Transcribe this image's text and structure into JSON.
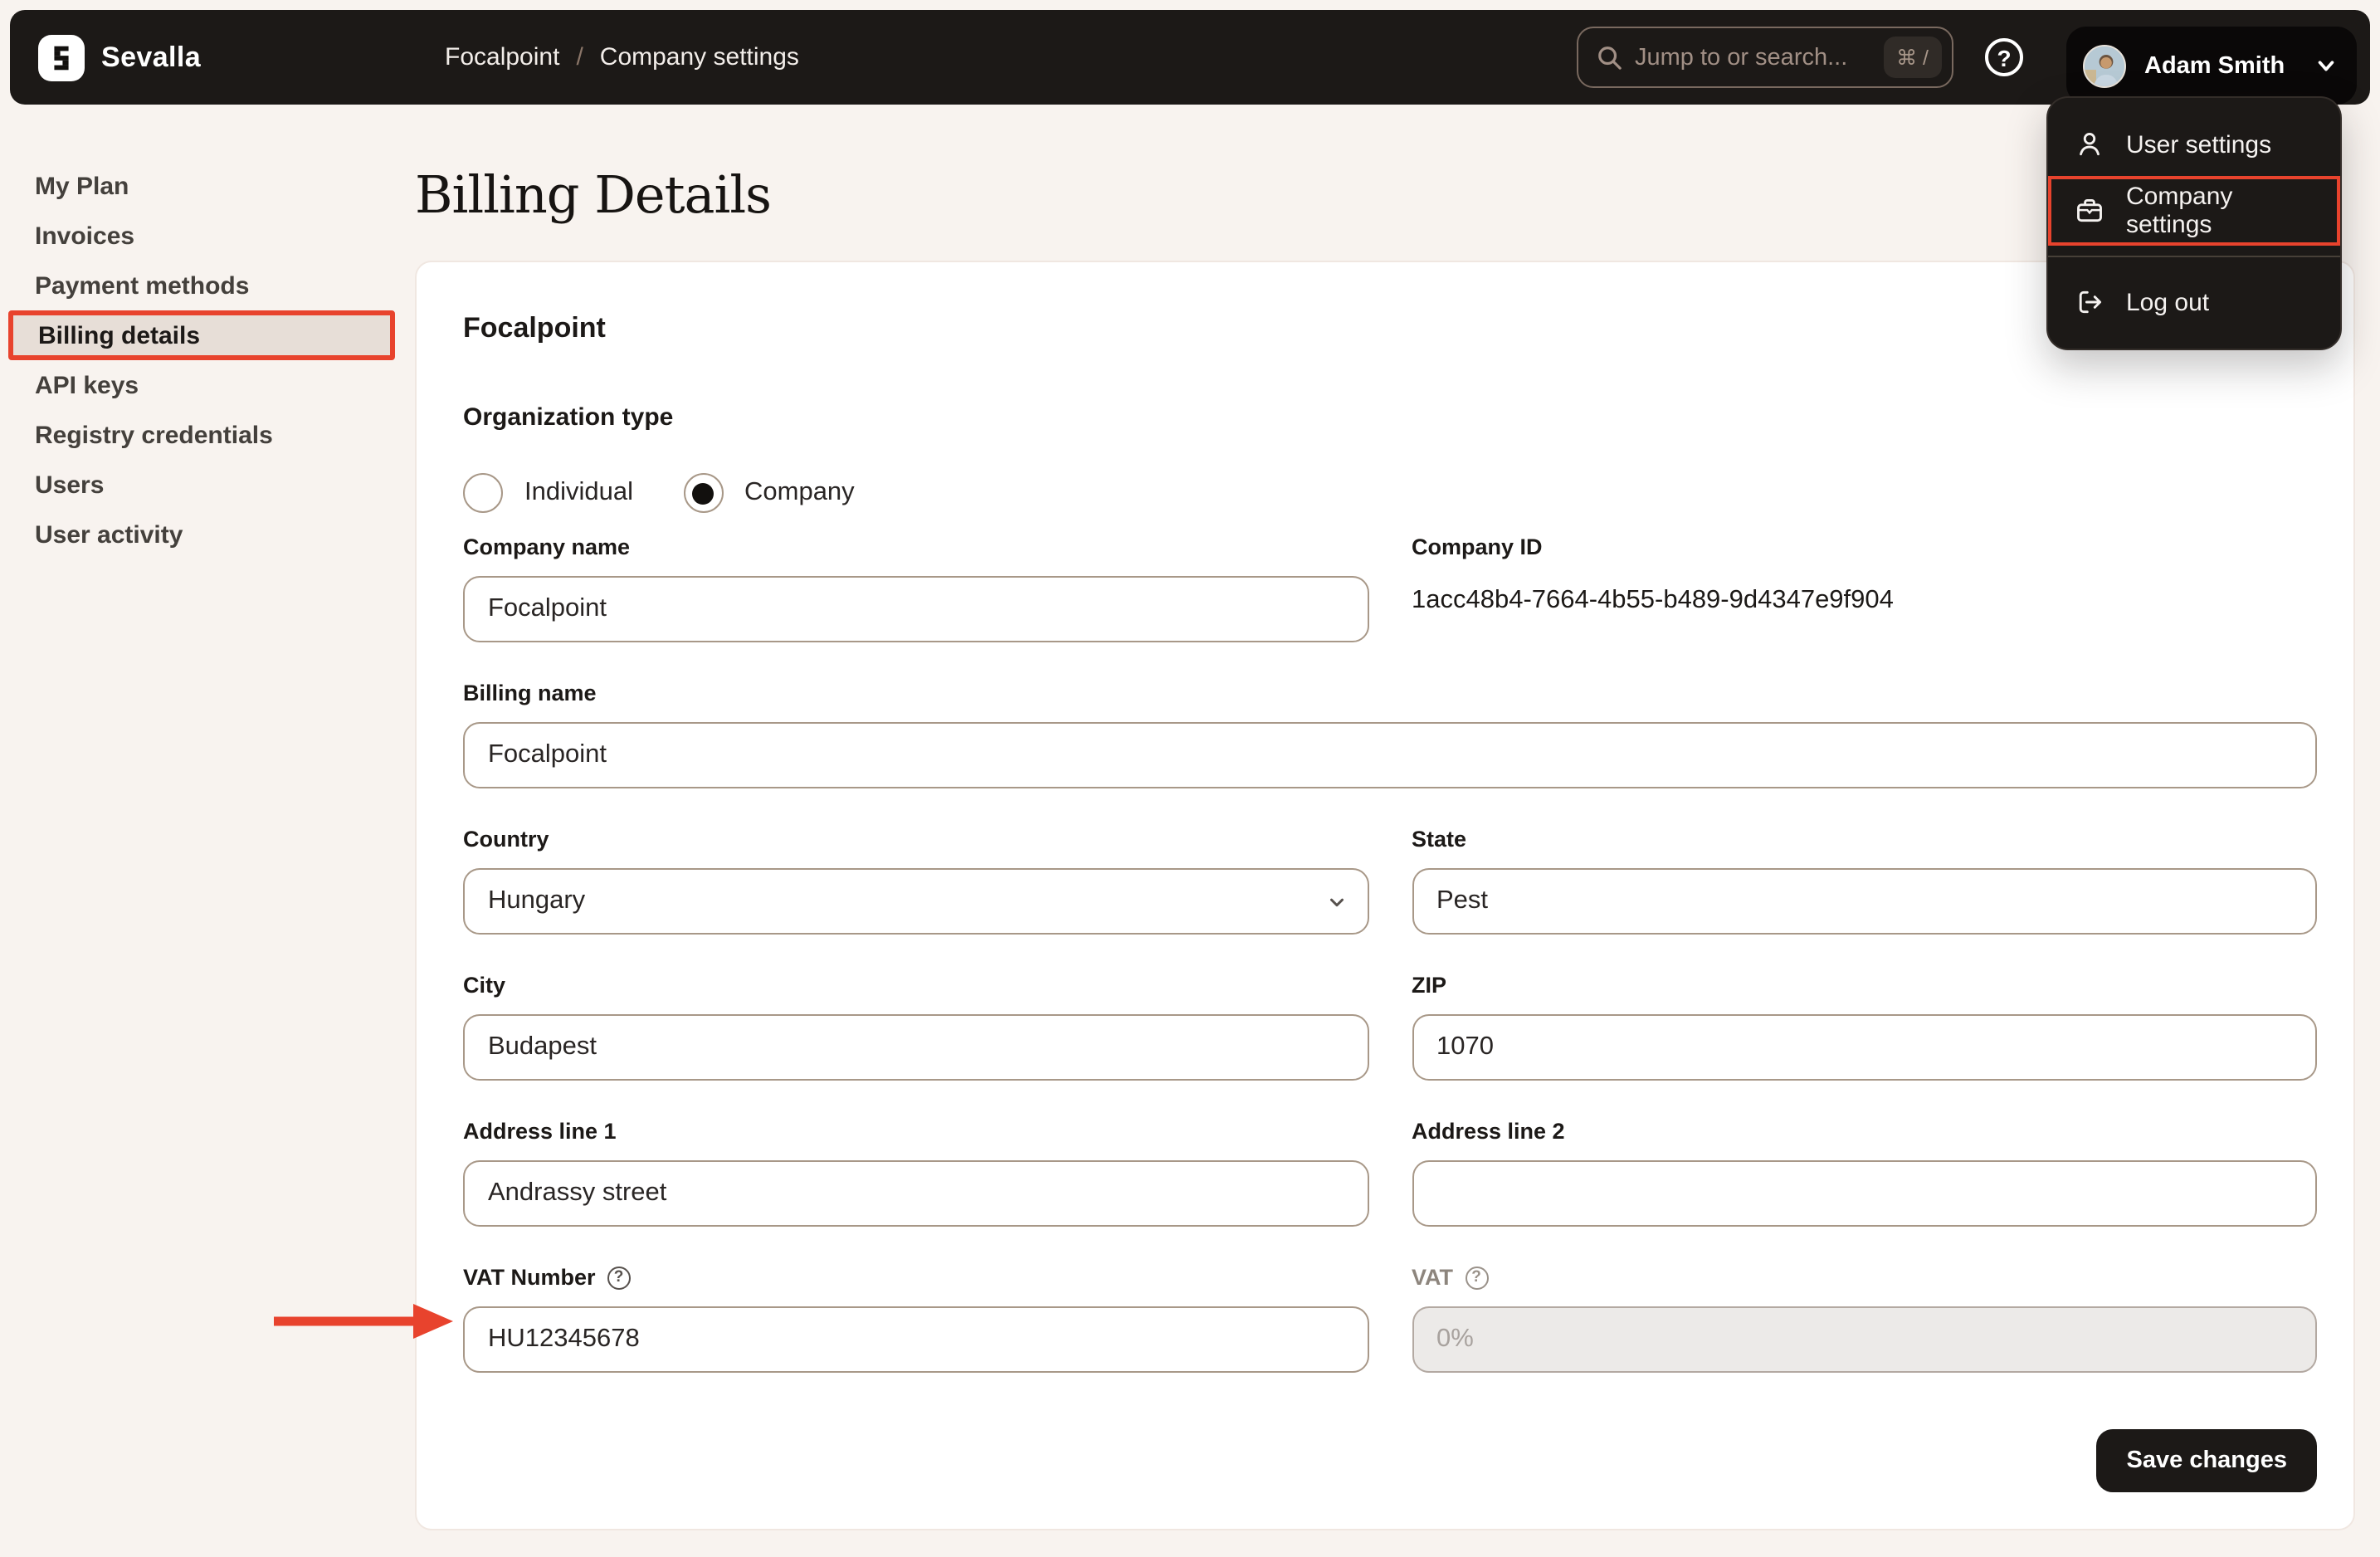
{
  "topbar": {
    "logo_text": "Sevalla",
    "breadcrumb": {
      "item1": "Focalpoint",
      "separator": "/",
      "item2": "Company settings"
    },
    "search": {
      "placeholder": "Jump to or search...",
      "shortcut": "⌘ /"
    },
    "help_glyph": "?",
    "user": {
      "name": "Adam Smith"
    }
  },
  "user_menu": {
    "items": [
      {
        "label": "User settings",
        "icon": "user-icon"
      },
      {
        "label": "Company settings",
        "icon": "briefcase-icon",
        "highlighted": true
      },
      {
        "label": "Log out",
        "icon": "logout-icon"
      }
    ]
  },
  "sidebar": {
    "items": [
      {
        "label": "My Plan"
      },
      {
        "label": "Invoices"
      },
      {
        "label": "Payment methods"
      },
      {
        "label": "Billing details",
        "active": true
      },
      {
        "label": "API keys"
      },
      {
        "label": "Registry credentials"
      },
      {
        "label": "Users"
      },
      {
        "label": "User activity"
      }
    ]
  },
  "main": {
    "page_title": "Billing Details",
    "card": {
      "title": "Focalpoint",
      "organization_type": {
        "label": "Organization type",
        "options": [
          {
            "label": "Individual",
            "selected": false
          },
          {
            "label": "Company",
            "selected": true
          }
        ]
      },
      "fields": {
        "company_name": {
          "label": "Company name",
          "value": "Focalpoint"
        },
        "company_id": {
          "label": "Company ID",
          "value": "1acc48b4-7664-4b55-b489-9d4347e9f904"
        },
        "billing_name": {
          "label": "Billing name",
          "value": "Focalpoint"
        },
        "country": {
          "label": "Country",
          "value": "Hungary"
        },
        "state": {
          "label": "State",
          "value": "Pest"
        },
        "city": {
          "label": "City",
          "value": "Budapest"
        },
        "zip": {
          "label": "ZIP",
          "value": "1070"
        },
        "address1": {
          "label": "Address line 1",
          "value": "Andrassy street"
        },
        "address2": {
          "label": "Address line 2",
          "value": ""
        },
        "vat_number": {
          "label": "VAT Number",
          "value": "HU12345678",
          "help_glyph": "?"
        },
        "vat": {
          "label": "VAT",
          "value": "0%",
          "help_glyph": "?",
          "disabled": true
        }
      },
      "save_button_label": "Save changes"
    }
  },
  "annotations": {
    "accent_color": "#E8432D",
    "highlighted_sidebar_item": "Billing details",
    "highlighted_menu_item": "Company settings",
    "arrow_target": "VAT Number input"
  }
}
